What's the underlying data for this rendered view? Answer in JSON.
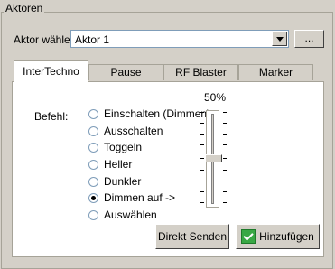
{
  "group": {
    "title": "Aktoren"
  },
  "aktor": {
    "label": "Aktor wählen:",
    "selected": "Aktor 1",
    "more_label": "..."
  },
  "tabs": [
    {
      "label": "InterTechno",
      "active": true
    },
    {
      "label": "Pause",
      "active": false
    },
    {
      "label": "RF Blaster",
      "active": false
    },
    {
      "label": "Marker",
      "active": false
    }
  ],
  "befehl": {
    "label": "Befehl:",
    "options": [
      {
        "label": "Einschalten (Dimmen)",
        "checked": false
      },
      {
        "label": "Ausschalten",
        "checked": false
      },
      {
        "label": "Toggeln",
        "checked": false
      },
      {
        "label": "Heller",
        "checked": false
      },
      {
        "label": "Dunkler",
        "checked": false
      },
      {
        "label": "Dimmen auf ->",
        "checked": true
      },
      {
        "label": "Auswählen",
        "checked": false
      }
    ]
  },
  "slider": {
    "percent_label": "50%",
    "value_percent": 50
  },
  "buttons": {
    "send_label": "Direkt Senden",
    "add_label": "Hinzufügen"
  },
  "icons": {
    "combo": "chevron-down-icon",
    "add": "checkmark-icon"
  },
  "colors": {
    "window": "#d4d0c8",
    "panel": "#ffffff",
    "accent_green": "#39a845"
  }
}
